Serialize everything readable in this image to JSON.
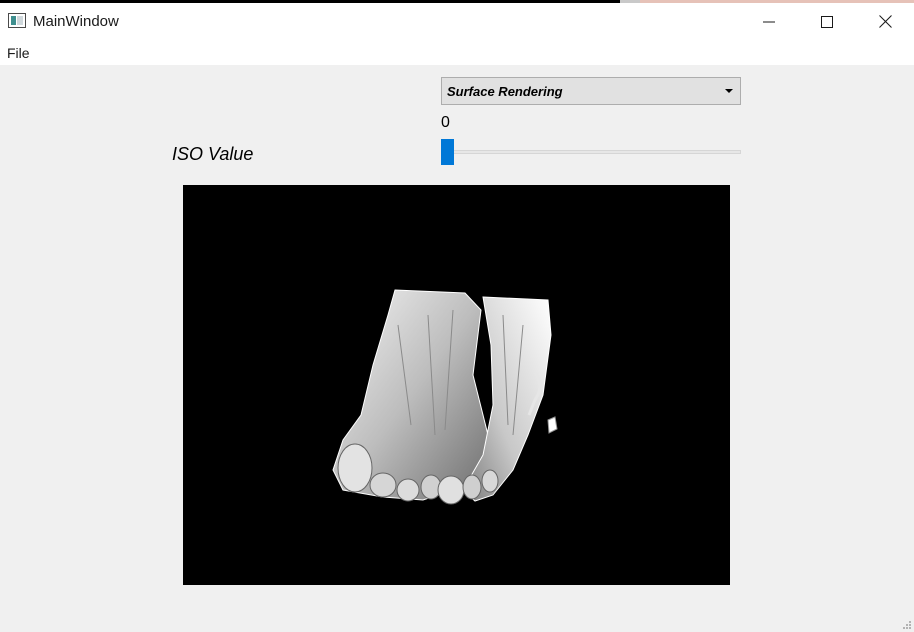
{
  "window": {
    "title": "MainWindow",
    "controls": [
      "minimize-icon",
      "maximize-icon",
      "close-icon"
    ]
  },
  "menubar": {
    "items": [
      {
        "label": "File"
      }
    ]
  },
  "render_mode": {
    "selected": "Surface Rendering"
  },
  "iso": {
    "label": "ISO Value",
    "value": "0",
    "slider_fraction": 0
  },
  "viewport": {
    "background": "#000000",
    "content": "3D surface rendering of feet"
  },
  "colors": {
    "accent": "#0078d7",
    "viewport_bg": "#000000"
  }
}
